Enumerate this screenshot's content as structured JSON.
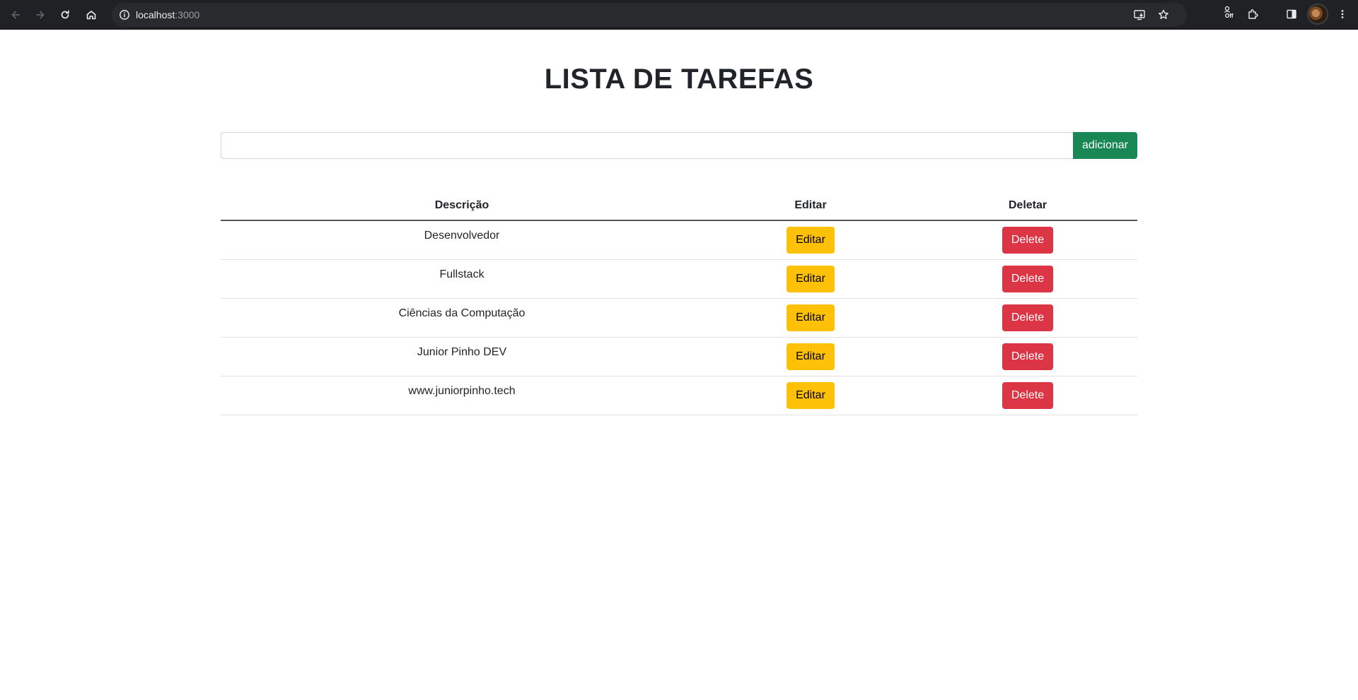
{
  "browser": {
    "url_host": "localhost",
    "url_port": ":3000",
    "extension_badge": "Off"
  },
  "page": {
    "title": "LISTA DE TAREFAS",
    "input": {
      "value": "",
      "placeholder": ""
    },
    "add_label": "adicionar"
  },
  "table": {
    "headers": {
      "description": "Descrição",
      "edit": "Editar",
      "delete": "Deletar"
    },
    "rows": [
      {
        "description": "Desenvolvedor",
        "edit_label": "Editar",
        "delete_label": "Delete"
      },
      {
        "description": "Fullstack",
        "edit_label": "Editar",
        "delete_label": "Delete"
      },
      {
        "description": "Ciências da Computação",
        "edit_label": "Editar",
        "delete_label": "Delete"
      },
      {
        "description": "Junior Pinho DEV",
        "edit_label": "Editar",
        "delete_label": "Delete"
      },
      {
        "description": "www.juniorpinho.tech",
        "edit_label": "Editar",
        "delete_label": "Delete"
      }
    ]
  },
  "colors": {
    "success": "#198754",
    "warning": "#ffc107",
    "danger": "#dc3545",
    "chrome_bg": "#202124"
  },
  "icons": [
    "back-icon",
    "forward-icon",
    "reload-icon",
    "home-icon",
    "site-info-icon",
    "install-app-icon",
    "bookmark-star-icon",
    "extension-off-icon",
    "extensions-puzzle-icon",
    "side-panel-icon",
    "profile-avatar",
    "menu-kebab-icon"
  ]
}
